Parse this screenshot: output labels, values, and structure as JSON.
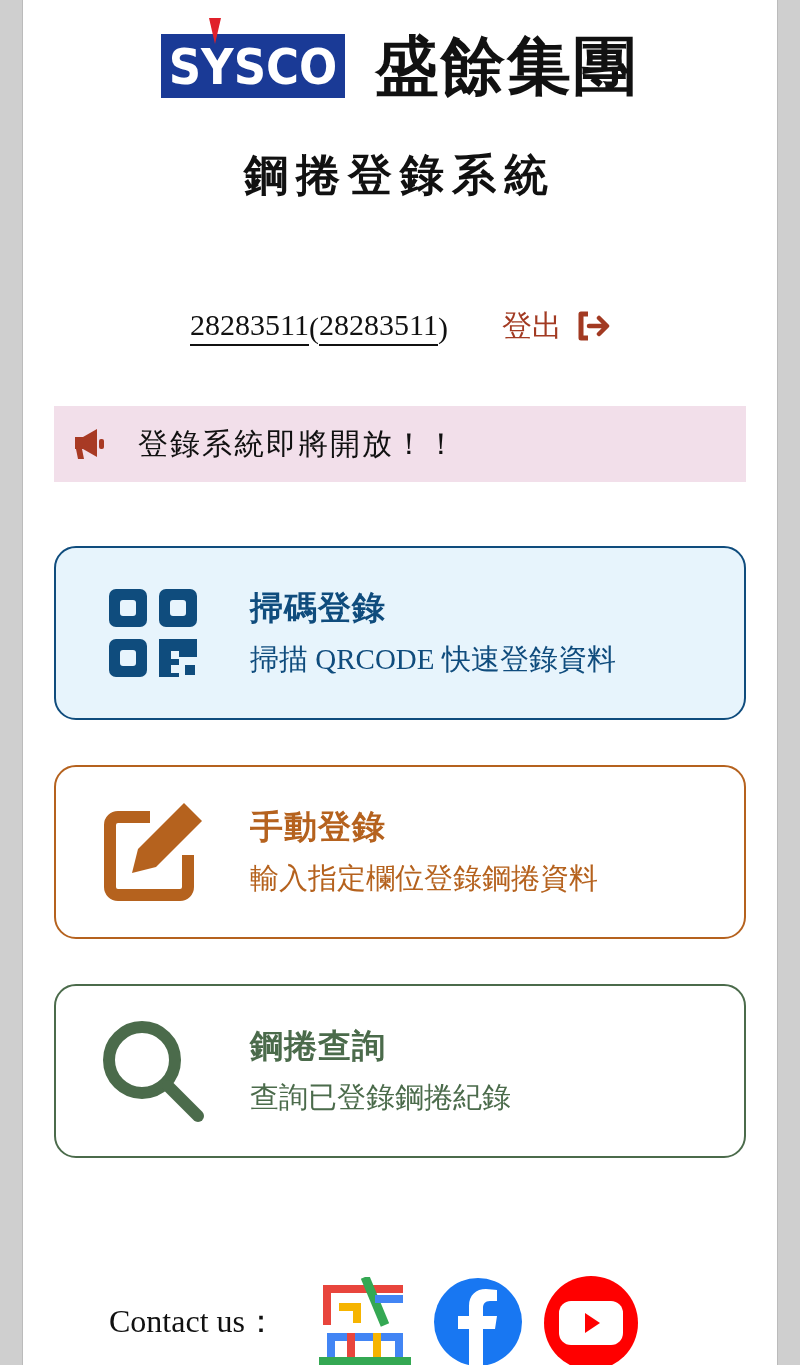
{
  "header": {
    "logo_text": "SYSCO",
    "company": "盛餘集團",
    "title": "鋼捲登錄系統"
  },
  "user": {
    "id": "28283511",
    "paren_open": "(",
    "name": "28283511",
    "paren_close": ")",
    "logout": "登出"
  },
  "notice": {
    "text": "登錄系統即將開放！！"
  },
  "cards": [
    {
      "kind": "qr",
      "title": "掃碼登錄",
      "subtitle": "掃描 QRCODE 快速登錄資料",
      "color": "#0f4c7d"
    },
    {
      "kind": "edit",
      "title": "手動登錄",
      "subtitle": "輸入指定欄位登錄鋼捲資料",
      "color": "#b5621e"
    },
    {
      "kind": "search",
      "title": "鋼捲查詢",
      "subtitle": "查詢已登錄鋼捲紀錄",
      "color": "#4b6b4b"
    }
  ],
  "footer": {
    "label": "Contact us："
  }
}
